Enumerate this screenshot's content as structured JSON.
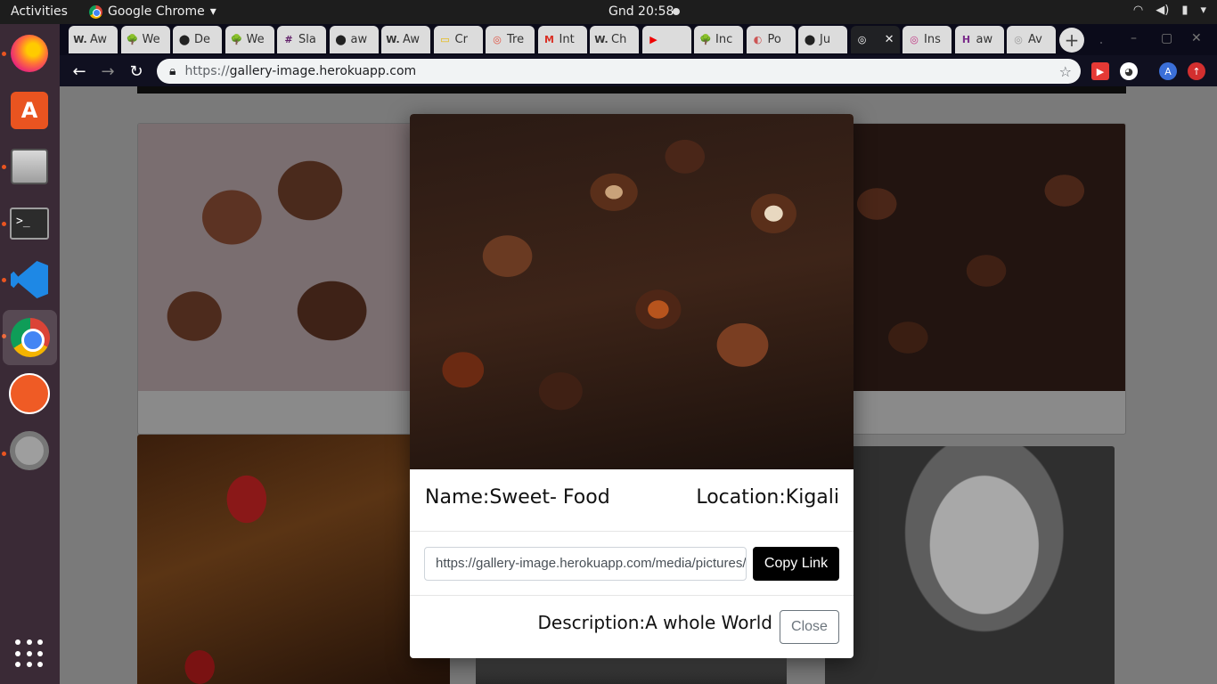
{
  "os": {
    "activities": "Activities",
    "app_name": "Google Chrome",
    "clock": "Gnd 20:58",
    "tray_icons": [
      "wifi-icon",
      "volume-icon",
      "battery-icon",
      "power-menu-icon"
    ]
  },
  "dock": {
    "items": [
      "firefox",
      "software-store",
      "files",
      "terminal",
      "vscode",
      "chrome",
      "postman",
      "settings-tools",
      "show-apps"
    ],
    "terminal_glyph": ">_",
    "store_glyph": "A"
  },
  "tabs": [
    {
      "fav": "W.",
      "label": "Aw"
    },
    {
      "fav": "🌳",
      "label": "We"
    },
    {
      "fav": "⬤",
      "label": "De"
    },
    {
      "fav": "🌳",
      "label": "We"
    },
    {
      "fav": "#",
      "label": "Sla"
    },
    {
      "fav": "⬤",
      "label": "aw"
    },
    {
      "fav": "W.",
      "label": "Aw"
    },
    {
      "fav": "▭",
      "label": "Cr"
    },
    {
      "fav": "◎",
      "label": "Tre"
    },
    {
      "fav": "M",
      "label": "Int"
    },
    {
      "fav": "W.",
      "label": "Ch"
    },
    {
      "fav": "▶",
      "label": ""
    },
    {
      "fav": "🌳",
      "label": "Inc"
    },
    {
      "fav": "◐",
      "label": "Po"
    },
    {
      "fav": "⬤",
      "label": "Ju"
    },
    {
      "fav": "◎",
      "label": "",
      "active": true
    },
    {
      "fav": "◎",
      "label": "Ins"
    },
    {
      "fav": "H",
      "label": "aw"
    },
    {
      "fav": "◎",
      "label": "Av"
    }
  ],
  "browser": {
    "url_scheme": "https://",
    "url_host": "gallery-image.herokuapp.com",
    "new_tab": "+"
  },
  "modal": {
    "name": "Name:Sweet- Food",
    "location": "Location:Kigali",
    "link": "https://gallery-image.herokuapp.com/media/pictures/",
    "copy_label": "Copy Link",
    "description": "Description:A whole World",
    "close_label": "Close"
  }
}
